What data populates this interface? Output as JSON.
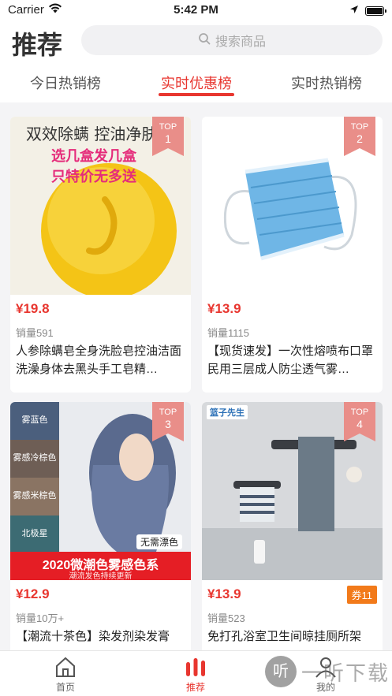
{
  "status": {
    "carrier": "Carrier",
    "time": "5:42 PM"
  },
  "header": {
    "title": "推荐",
    "search_placeholder": "搜索商品",
    "tabs": [
      "今日热销榜",
      "实时优惠榜",
      "实时热销榜"
    ],
    "active_tab": 1
  },
  "products": [
    {
      "rank_label": "TOP",
      "rank": "1",
      "price": "¥19.8",
      "sold": "销量591",
      "title": "人参除螨皂全身洗脸皂控油洁面洗澡身体去黑头手工皂精…",
      "banner_lines": [
        "双效除螨 控油净肤",
        "选几盒发几盒",
        "只特价无多送"
      ]
    },
    {
      "rank_label": "TOP",
      "rank": "2",
      "price": "¥13.9",
      "sold": "销量1115",
      "title": "【现货速发】一次性熔喷布口罩民用三层成人防尘透气雾…"
    },
    {
      "rank_label": "TOP",
      "rank": "3",
      "price": "¥12.9",
      "sold": "销量10万+",
      "title": "【潮流十茶色】染发剂染发膏",
      "swatches": [
        "雾蓝色",
        "雾感冷棕色",
        "雾感米棕色",
        "北极星"
      ],
      "tag": "无需漂色",
      "banner": "2020微潮色雾感色系",
      "banner_sub": "潮流发色持续更新"
    },
    {
      "rank_label": "TOP",
      "rank": "4",
      "price": "¥13.9",
      "sold": "销量523",
      "title": "免打孔浴室卫生间晾挂厕所架",
      "coupon": "券11",
      "brand": "篮子先生"
    }
  ],
  "tabbar": {
    "items": [
      "首页",
      "推荐",
      "我的"
    ],
    "active": 1
  },
  "watermark": {
    "icon_char": "听",
    "text": "一听下载"
  },
  "colors": {
    "accent": "#e8362f",
    "coupon": "#f27a1a",
    "badge": "#e98e89"
  }
}
